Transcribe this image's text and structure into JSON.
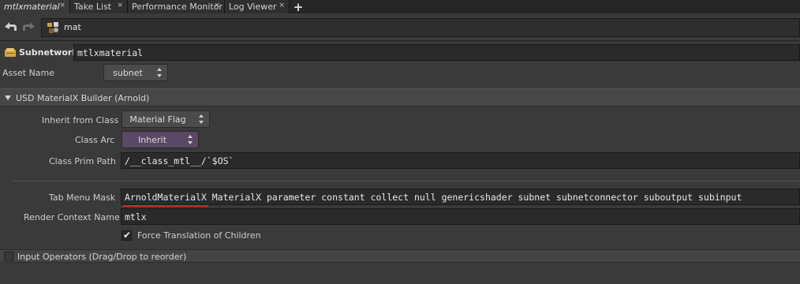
{
  "tabs": [
    {
      "label": "mtlxmaterial",
      "active": true
    },
    {
      "label": "Take List",
      "active": false
    },
    {
      "label": "Performance Monitor",
      "active": false
    },
    {
      "label": "Log Viewer",
      "active": false
    }
  ],
  "tab_close_glyph": "×",
  "tab_add_glyph": "+",
  "path": {
    "text": "mat",
    "icon": "material-network-icon"
  },
  "node": {
    "type_label": "Subnetwork",
    "name": "mtlxmaterial",
    "icon": "subnet-box-icon"
  },
  "asset_name": {
    "label": "Asset Name",
    "value": "subnet"
  },
  "section": {
    "title": "USD MaterialX Builder (Arnold)",
    "expanded": true
  },
  "inherit_from_class": {
    "label": "Inherit from Class",
    "value": "Material Flag"
  },
  "class_arc": {
    "label": "Class Arc",
    "value": "Inherit",
    "accent": "#5a4866"
  },
  "class_prim_path": {
    "label": "Class Prim Path",
    "value": "/__class_mtl__/`$OS`"
  },
  "tab_menu_mask": {
    "label": "Tab Menu Mask",
    "value": "ArnoldMaterialX MaterialX parameter constant collect null genericshader subnet subnetconnector suboutput subinput",
    "underline_color": "#d62828"
  },
  "render_context": {
    "label": "Render Context Name",
    "value": "mtlx"
  },
  "force_translation": {
    "label": "Force Translation of Children",
    "checked": true,
    "glyph": "✔"
  },
  "input_operators": {
    "label": "Input Operators (Drag/Drop to reorder)"
  }
}
